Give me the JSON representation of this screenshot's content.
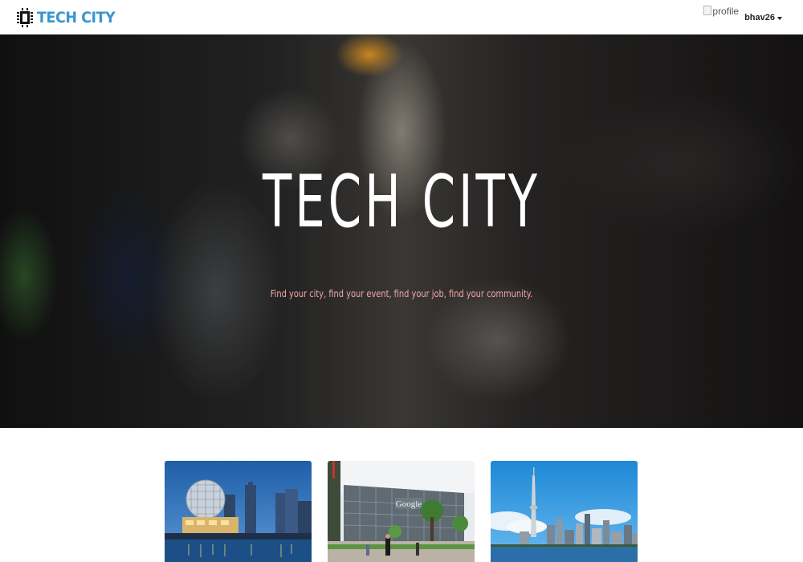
{
  "navbar": {
    "brand": "TECH CITY",
    "brand_color": "#3a96ce",
    "logo_icon": "chip-icon",
    "profile_alt": "profile",
    "username": "bhav26"
  },
  "hero": {
    "title": "TECH CITY",
    "subtitle": "Find your city, find your event, find your job, find your community.",
    "subtitle_color": "#f3a7a7"
  },
  "cities": [
    {
      "image": "vancouver-science-world-skyline"
    },
    {
      "image": "google-office-campus"
    },
    {
      "image": "toronto-cn-tower-skyline"
    }
  ]
}
